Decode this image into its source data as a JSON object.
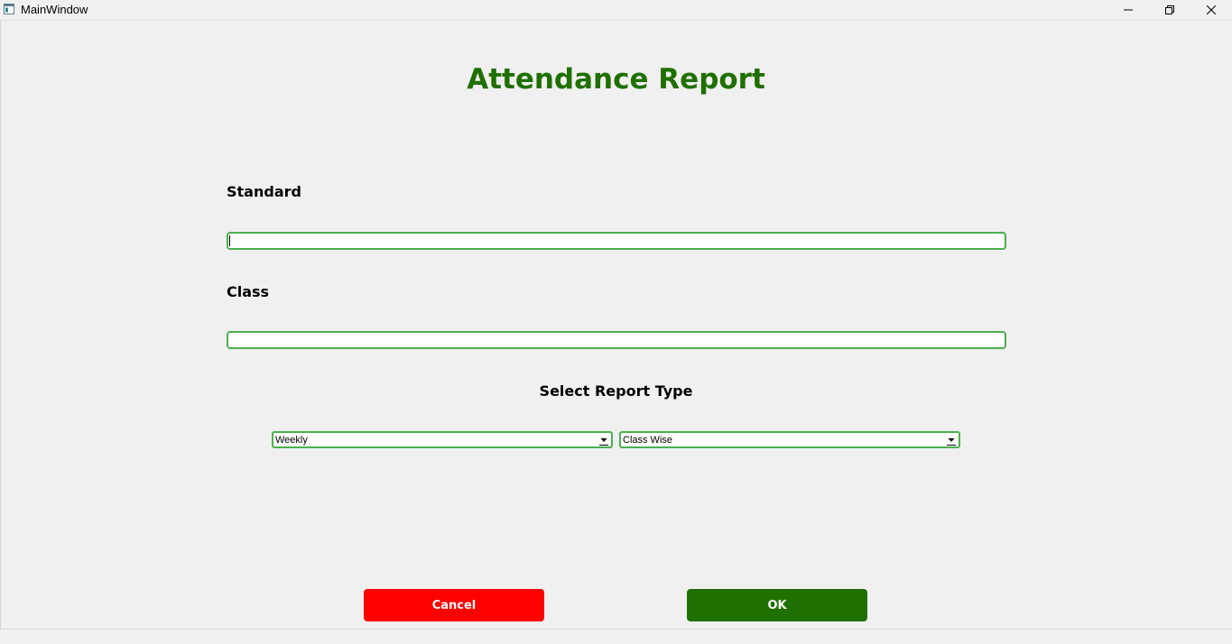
{
  "window": {
    "title": "MainWindow",
    "icon": "app-window-icon",
    "controls": [
      "minimize-icon",
      "restore-icon",
      "close-icon"
    ]
  },
  "page": {
    "title": "Attendance Report",
    "title_color": "#1f7000"
  },
  "form": {
    "standard_label": "Standard",
    "standard_value": "",
    "class_label": "Class",
    "class_value": "",
    "report_type_label": "Select Report Type",
    "period_selected": "Weekly",
    "scope_selected": "Class Wise",
    "border_color": "#4caf50"
  },
  "actions": {
    "cancel_label": "Cancel",
    "cancel_color": "#ff0000",
    "ok_label": "OK",
    "ok_color": "#1f7000"
  }
}
